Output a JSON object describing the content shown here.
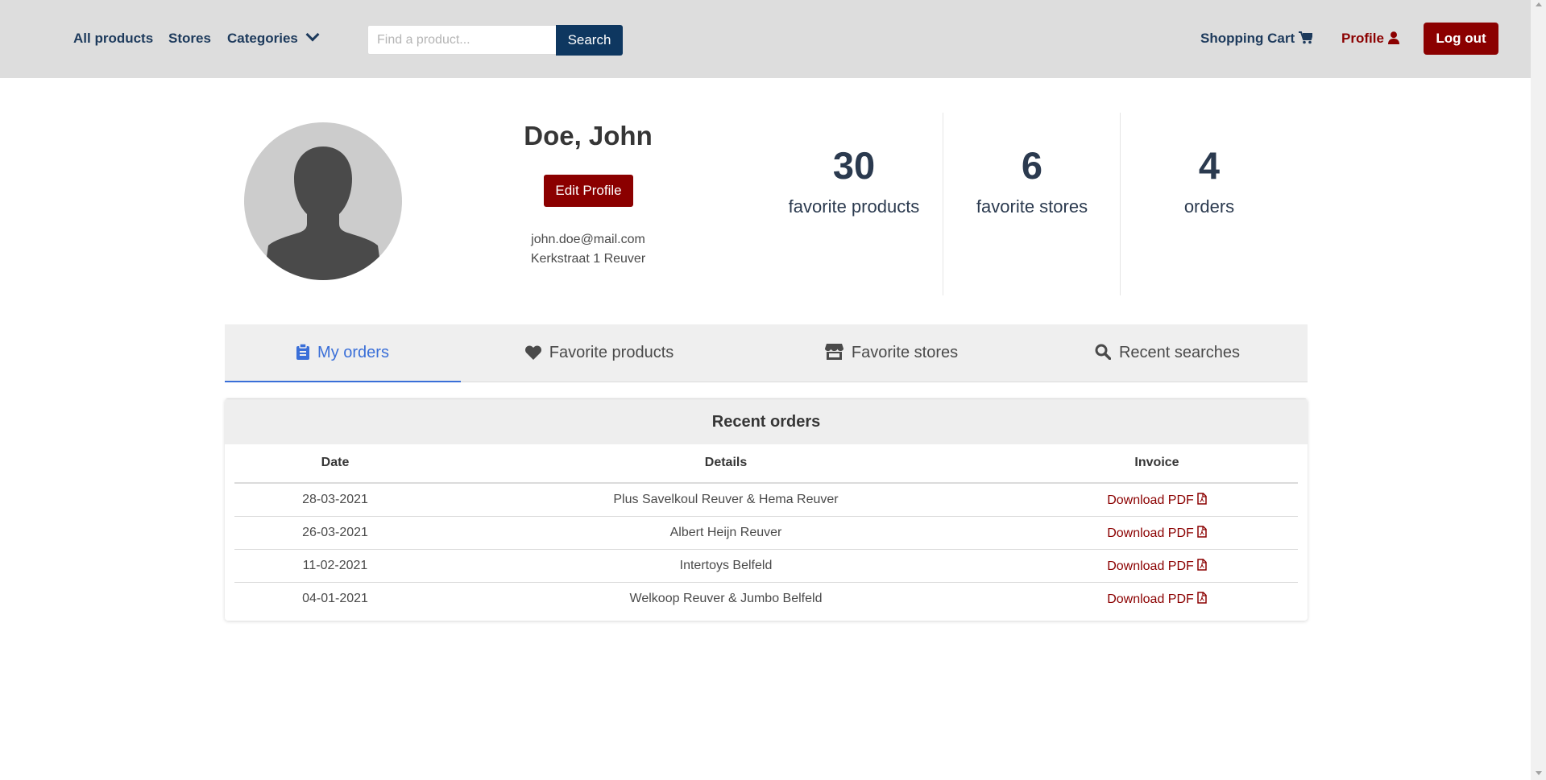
{
  "nav": {
    "all_products": "All products",
    "stores": "Stores",
    "categories": "Categories",
    "search_placeholder": "Find a product...",
    "search_button": "Search",
    "cart": "Shopping Cart",
    "profile": "Profile",
    "logout": "Log out"
  },
  "profile": {
    "name": "Doe, John",
    "edit_button": "Edit Profile",
    "email": "john.doe@mail.com",
    "address": "Kerkstraat 1 Reuver"
  },
  "stats": [
    {
      "value": "30",
      "label": "favorite products"
    },
    {
      "value": "6",
      "label": "favorite stores"
    },
    {
      "value": "4",
      "label": "orders"
    }
  ],
  "tabs": [
    {
      "label": "My orders",
      "icon": "clipboard-icon",
      "active": true
    },
    {
      "label": "Favorite products",
      "icon": "heart-icon"
    },
    {
      "label": "Favorite stores",
      "icon": "store-icon"
    },
    {
      "label": "Recent searches",
      "icon": "search-icon"
    }
  ],
  "orders": {
    "title": "Recent orders",
    "columns": [
      "Date",
      "Details",
      "Invoice"
    ],
    "rows": [
      {
        "date": "28-03-2021",
        "details": "Plus Savelkoul Reuver & Hema Reuver",
        "invoice": "Download PDF"
      },
      {
        "date": "26-03-2021",
        "details": "Albert Heijn Reuver",
        "invoice": "Download PDF"
      },
      {
        "date": "11-02-2021",
        "details": "Intertoys Belfeld",
        "invoice": "Download PDF"
      },
      {
        "date": "04-01-2021",
        "details": "Welkoop Reuver & Jumbo Belfeld",
        "invoice": "Download PDF"
      }
    ]
  },
  "colors": {
    "navbar_bg": "#dddddd",
    "nav_text": "#1d3a5c",
    "accent_red": "#8b0000",
    "search_button": "#0e3760",
    "active_tab": "#3a6fd8"
  }
}
